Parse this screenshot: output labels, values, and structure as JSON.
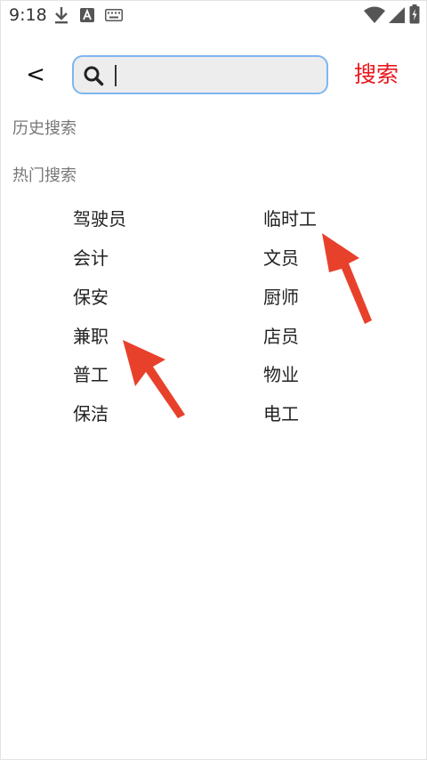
{
  "status_bar": {
    "time": "9:18",
    "icons": [
      "download-icon",
      "text-a-icon",
      "keyboard-icon",
      "wifi-icon",
      "signal-icon",
      "battery-icon"
    ]
  },
  "search": {
    "back_label": "<",
    "placeholder": "",
    "value": "",
    "button_label": "搜索",
    "accent_color": "#e8161c",
    "border_color": "#7fb6ef"
  },
  "history": {
    "title": "历史搜索"
  },
  "hot": {
    "title": "热门搜索",
    "items": [
      "驾驶员",
      "临时工",
      "会计",
      "文员",
      "保安",
      "厨师",
      "兼职",
      "店员",
      "普工",
      "物业",
      "保洁",
      "电工"
    ]
  },
  "annotation_color": "#e8412b"
}
